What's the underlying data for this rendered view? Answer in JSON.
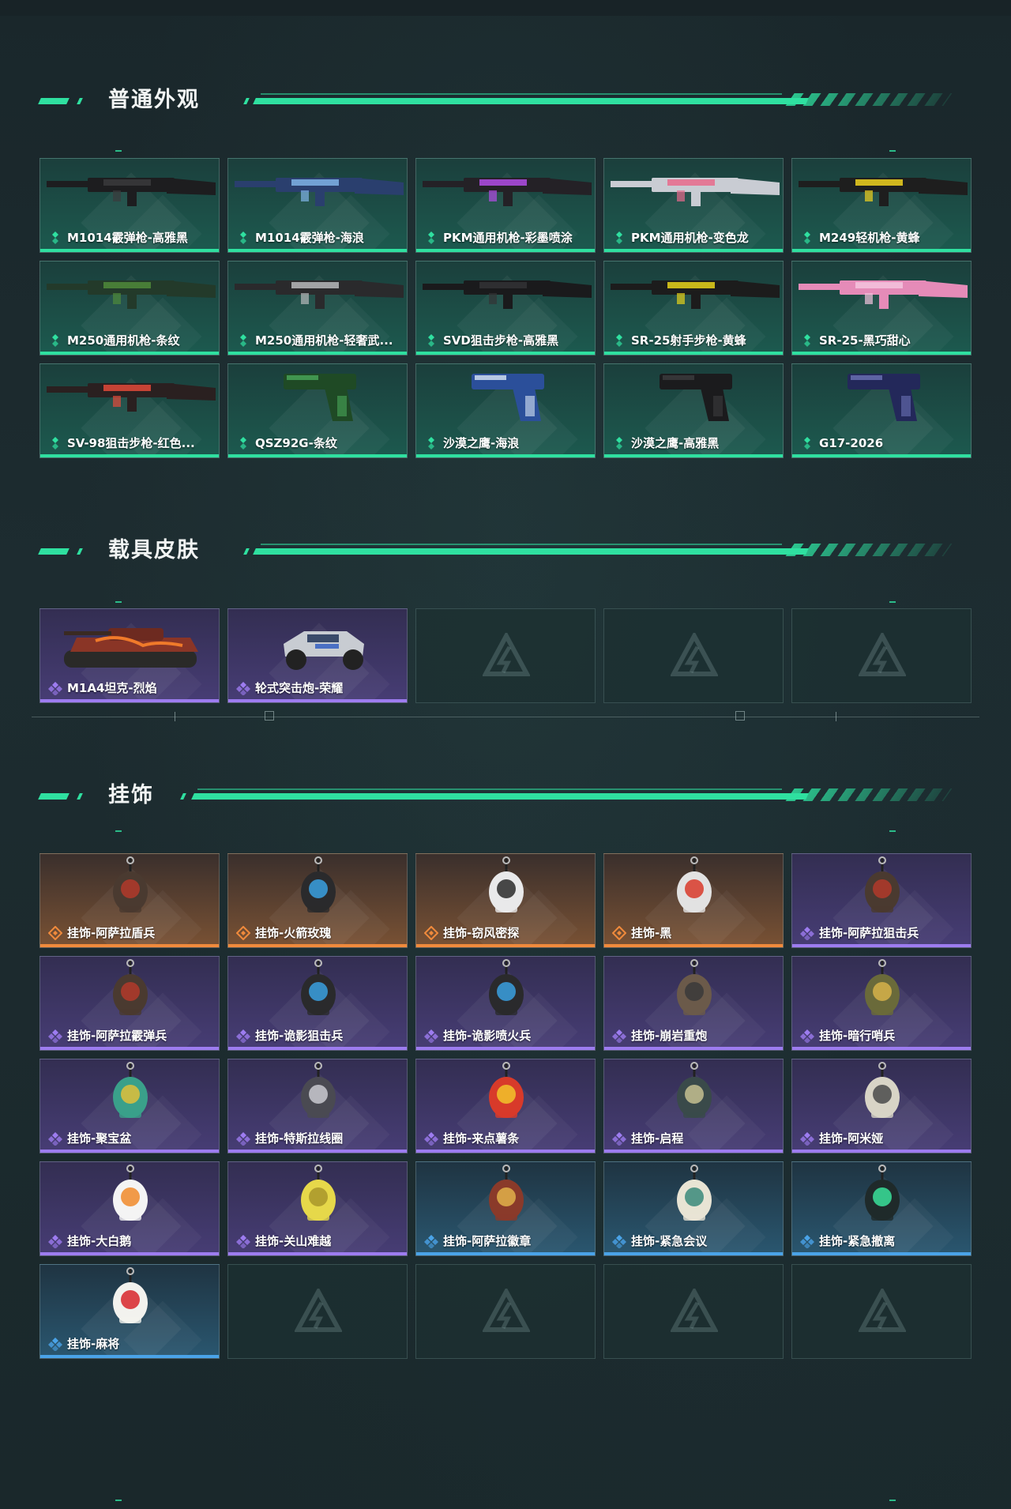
{
  "sections": [
    {
      "title": "普通外观",
      "items": [
        {
          "label": "M1014霰弹枪-高雅黑",
          "rarity": "green",
          "art": "shotgun-black"
        },
        {
          "label": "M1014霰弹枪-海浪",
          "rarity": "green",
          "art": "shotgun-wave"
        },
        {
          "label": "PKM通用机枪-彩墨喷涂",
          "rarity": "green",
          "art": "mg-purple"
        },
        {
          "label": "PKM通用机枪-变色龙",
          "rarity": "green",
          "art": "mg-white"
        },
        {
          "label": "M249轻机枪-黄蜂",
          "rarity": "green",
          "art": "lmg-yellow"
        },
        {
          "label": "M250通用机枪-条纹",
          "rarity": "green",
          "art": "mg-green"
        },
        {
          "label": "M250通用机枪-轻奢武...",
          "rarity": "green",
          "art": "mg-silver"
        },
        {
          "label": "SVD狙击步枪-高雅黑",
          "rarity": "green",
          "art": "sniper-black"
        },
        {
          "label": "SR-25射手步枪-黄蜂",
          "rarity": "green",
          "art": "rifle-yellow"
        },
        {
          "label": "SR-25-黑巧甜心",
          "rarity": "green",
          "art": "rifle-pink"
        },
        {
          "label": "SV-98狙击步枪-红色...",
          "rarity": "green",
          "art": "sniper-red"
        },
        {
          "label": "QSZ92G-条纹",
          "rarity": "green",
          "art": "pistol-green"
        },
        {
          "label": "沙漠之鹰-海浪",
          "rarity": "green",
          "art": "pistol-blue"
        },
        {
          "label": "沙漠之鹰-高雅黑",
          "rarity": "green",
          "art": "pistol-black"
        },
        {
          "label": "G17-2026",
          "rarity": "green",
          "art": "pistol-navy"
        }
      ]
    },
    {
      "title": "载具皮肤",
      "items": [
        {
          "label": "M1A4坦克-烈焰",
          "rarity": "purple",
          "art": "tank"
        },
        {
          "label": "轮式突击炮-荣耀",
          "rarity": "purple",
          "art": "buggy"
        },
        {
          "label": "",
          "rarity": "empty"
        },
        {
          "label": "",
          "rarity": "empty"
        },
        {
          "label": "",
          "rarity": "empty"
        }
      ]
    },
    {
      "title": "挂饰",
      "items": [
        {
          "label": "挂饰-阿萨拉盾兵",
          "rarity": "orange",
          "art": "charm-soldier"
        },
        {
          "label": "挂饰-火箭玫瑰",
          "rarity": "orange",
          "art": "charm-helmet"
        },
        {
          "label": "挂饰-窃风密探",
          "rarity": "orange",
          "art": "charm-white"
        },
        {
          "label": "挂饰-黑",
          "rarity": "orange",
          "art": "charm-tag"
        },
        {
          "label": "挂饰-阿萨拉狙击兵",
          "rarity": "purple",
          "art": "charm-soldier"
        },
        {
          "label": "挂饰-阿萨拉霰弹兵",
          "rarity": "purple",
          "art": "charm-soldier"
        },
        {
          "label": "挂饰-诡影狙击兵",
          "rarity": "purple",
          "art": "charm-helmet"
        },
        {
          "label": "挂饰-诡影喷火兵",
          "rarity": "purple",
          "art": "charm-helmet"
        },
        {
          "label": "挂饰-崩岩重炮",
          "rarity": "purple",
          "art": "charm-brown"
        },
        {
          "label": "挂饰-暗行哨兵",
          "rarity": "purple",
          "art": "charm-olive"
        },
        {
          "label": "挂饰-聚宝盆",
          "rarity": "purple",
          "art": "charm-bowl"
        },
        {
          "label": "挂饰-特斯拉线圈",
          "rarity": "purple",
          "art": "charm-coil"
        },
        {
          "label": "挂饰-来点薯条",
          "rarity": "purple",
          "art": "charm-fries"
        },
        {
          "label": "挂饰-启程",
          "rarity": "purple",
          "art": "charm-medal"
        },
        {
          "label": "挂饰-阿米娅",
          "rarity": "purple",
          "art": "charm-bunny"
        },
        {
          "label": "挂饰-大白鹅",
          "rarity": "purple",
          "art": "charm-goose"
        },
        {
          "label": "挂饰-关山难越",
          "rarity": "purple",
          "art": "charm-can"
        },
        {
          "label": "挂饰-阿萨拉徽章",
          "rarity": "blue",
          "art": "charm-badge"
        },
        {
          "label": "挂饰-紧急会议",
          "rarity": "blue",
          "art": "charm-shield"
        },
        {
          "label": "挂饰-紧急撤离",
          "rarity": "blue",
          "art": "charm-box"
        },
        {
          "label": "挂饰-麻将",
          "rarity": "blue",
          "art": "charm-mahjong"
        },
        {
          "label": "",
          "rarity": "empty"
        },
        {
          "label": "",
          "rarity": "empty"
        },
        {
          "label": "",
          "rarity": "empty"
        },
        {
          "label": "",
          "rarity": "empty"
        }
      ]
    }
  ],
  "colors": {
    "accent": "#2fe0a0",
    "rarity_green": "#2fe0a0",
    "rarity_purple": "#9d7cf0",
    "rarity_orange": "#f08a3c",
    "rarity_blue": "#4aa3e8"
  }
}
